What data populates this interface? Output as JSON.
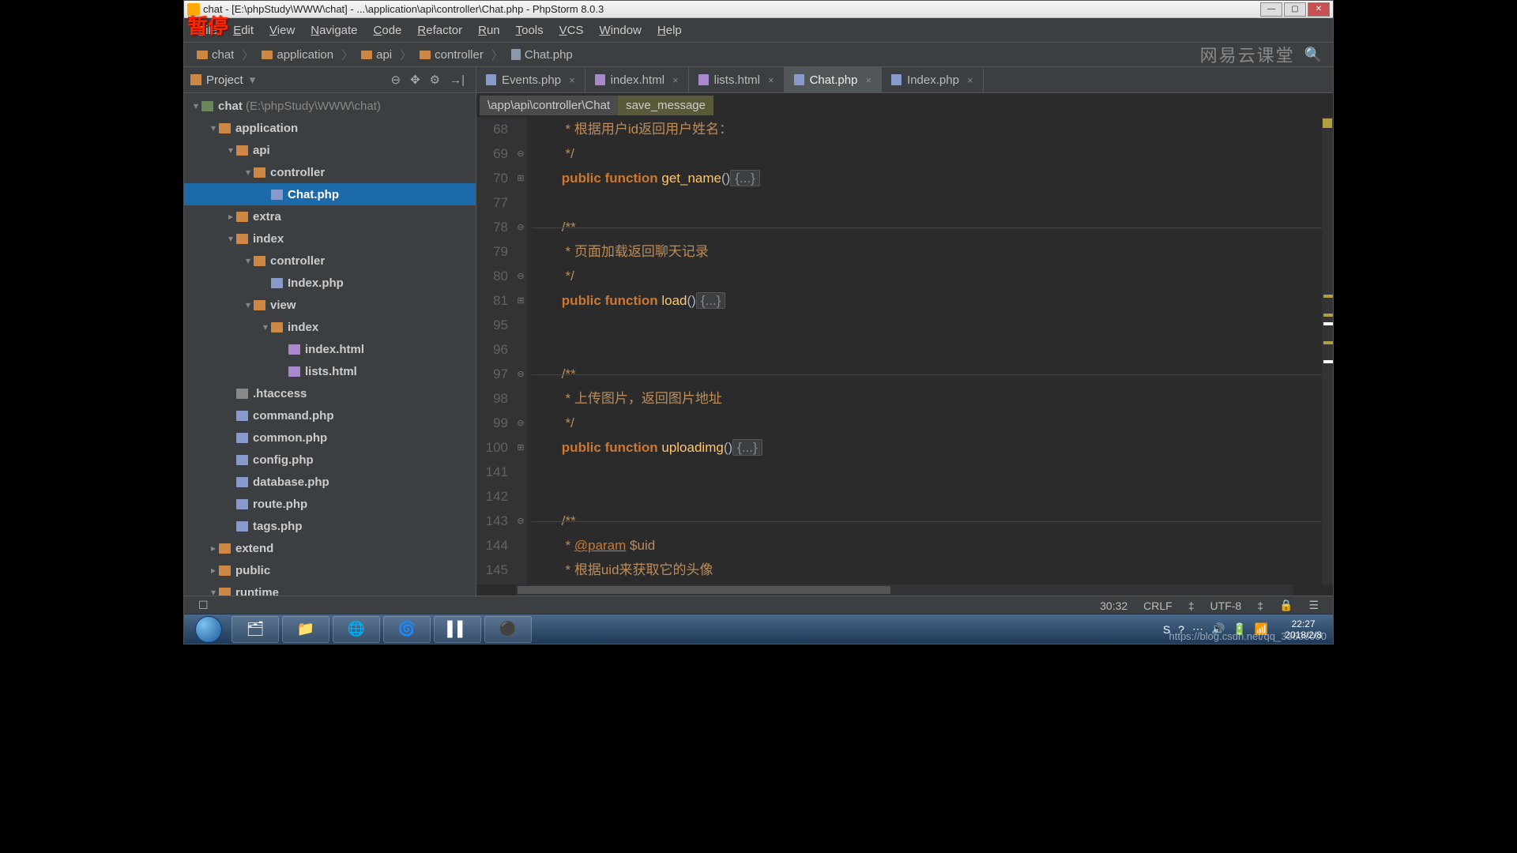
{
  "overlay": {
    "pause": "暂停"
  },
  "title": "chat - [E:\\phpStudy\\WWW\\chat] - ...\\application\\api\\controller\\Chat.php - PhpStorm 8.0.3",
  "menu": [
    "File",
    "Edit",
    "View",
    "Navigate",
    "Code",
    "Refactor",
    "Run",
    "Tools",
    "VCS",
    "Window",
    "Help"
  ],
  "breadcrumb": [
    {
      "type": "folder",
      "label": "chat"
    },
    {
      "type": "folder",
      "label": "application"
    },
    {
      "type": "folder",
      "label": "api"
    },
    {
      "type": "folder",
      "label": "controller"
    },
    {
      "type": "file",
      "label": "Chat.php"
    }
  ],
  "watermark_brand": "网易云课堂",
  "url_watermark": "https://blog.csdn.net/qq_33608000",
  "project": {
    "header": "Project",
    "tree": [
      {
        "d": 0,
        "t": "▾",
        "icon": "module",
        "label": "chat",
        "suffix": " (E:\\phpStudy\\WWW\\chat)"
      },
      {
        "d": 1,
        "t": "▾",
        "icon": "folder",
        "label": "application"
      },
      {
        "d": 2,
        "t": "▾",
        "icon": "folder",
        "label": "api"
      },
      {
        "d": 3,
        "t": "▾",
        "icon": "folder",
        "label": "controller"
      },
      {
        "d": 4,
        "t": "",
        "icon": "php",
        "label": "Chat.php",
        "selected": true
      },
      {
        "d": 2,
        "t": "▸",
        "icon": "folder",
        "label": "extra"
      },
      {
        "d": 2,
        "t": "▾",
        "icon": "folder",
        "label": "index"
      },
      {
        "d": 3,
        "t": "▾",
        "icon": "folder",
        "label": "controller"
      },
      {
        "d": 4,
        "t": "",
        "icon": "php",
        "label": "Index.php"
      },
      {
        "d": 3,
        "t": "▾",
        "icon": "folder",
        "label": "view"
      },
      {
        "d": 4,
        "t": "▾",
        "icon": "folder",
        "label": "index"
      },
      {
        "d": 5,
        "t": "",
        "icon": "html",
        "label": "index.html"
      },
      {
        "d": 5,
        "t": "",
        "icon": "html",
        "label": "lists.html"
      },
      {
        "d": 2,
        "t": "",
        "icon": "file",
        "label": ".htaccess"
      },
      {
        "d": 2,
        "t": "",
        "icon": "php",
        "label": "command.php"
      },
      {
        "d": 2,
        "t": "",
        "icon": "php",
        "label": "common.php"
      },
      {
        "d": 2,
        "t": "",
        "icon": "php",
        "label": "config.php"
      },
      {
        "d": 2,
        "t": "",
        "icon": "php",
        "label": "database.php"
      },
      {
        "d": 2,
        "t": "",
        "icon": "php",
        "label": "route.php"
      },
      {
        "d": 2,
        "t": "",
        "icon": "php",
        "label": "tags.php"
      },
      {
        "d": 1,
        "t": "▸",
        "icon": "folder",
        "label": "extend"
      },
      {
        "d": 1,
        "t": "▸",
        "icon": "folder",
        "label": "public"
      },
      {
        "d": 1,
        "t": "▾",
        "icon": "folder",
        "label": "runtime"
      }
    ]
  },
  "tabs": [
    {
      "label": "Events.php",
      "icon": "php"
    },
    {
      "label": "index.html",
      "icon": "html"
    },
    {
      "label": "lists.html",
      "icon": "html"
    },
    {
      "label": "Chat.php",
      "icon": "php",
      "active": true
    },
    {
      "label": "Index.php",
      "icon": "php"
    }
  ],
  "path_crumb": {
    "ns": "\\app\\api\\controller\\Chat",
    "member": "save_message"
  },
  "code": [
    {
      "n": 68,
      "f": "",
      "html": "         <span class='doc'>* 根据用户id返回用户姓名：</span>"
    },
    {
      "n": 69,
      "f": "⊖",
      "html": "         <span class='doc'>*/</span>"
    },
    {
      "n": 70,
      "f": "⊞",
      "html": "        <span class='kw'>public</span> <span class='kw'>function</span> <span class='fn'>get_name</span>()<span class='fold'>{...}</span>"
    },
    {
      "n": 77,
      "f": "",
      "html": ""
    },
    {
      "n": 78,
      "f": "⊖",
      "html": "        <span class='doc'>/**</span>",
      "sep": true
    },
    {
      "n": 79,
      "f": "",
      "html": "         <span class='doc'>* 页面加载返回聊天记录</span>"
    },
    {
      "n": 80,
      "f": "⊖",
      "html": "         <span class='doc'>*/</span>"
    },
    {
      "n": 81,
      "f": "⊞",
      "html": "        <span class='kw'>public</span> <span class='kw'>function</span> <span class='fn'>load</span>()<span class='fold'>{...}</span>"
    },
    {
      "n": 95,
      "f": "",
      "html": ""
    },
    {
      "n": 96,
      "f": "",
      "html": ""
    },
    {
      "n": 97,
      "f": "⊖",
      "html": "        <span class='doc'>/**</span>",
      "sep": true
    },
    {
      "n": 98,
      "f": "",
      "html": "         <span class='doc'>* 上传图片，返回图片地址</span>"
    },
    {
      "n": 99,
      "f": "⊖",
      "html": "         <span class='doc'>*/</span>"
    },
    {
      "n": 100,
      "f": "⊞",
      "html": "        <span class='kw'>public</span> <span class='kw'>function</span> <span class='fn'>uploadimg</span>()<span class='fold'>{...}</span>"
    },
    {
      "n": 141,
      "f": "",
      "html": ""
    },
    {
      "n": 142,
      "f": "",
      "html": ""
    },
    {
      "n": 143,
      "f": "⊖",
      "html": "        <span class='doc'>/**</span>",
      "sep": true
    },
    {
      "n": 144,
      "f": "",
      "html": "         <span class='doc'>* <span class='doctag'>@param</span> $uid</span>"
    },
    {
      "n": 145,
      "f": "",
      "html": "         <span class='doc'>* 根据uid来获取它的头像</span>"
    }
  ],
  "status": {
    "pos": "30:32",
    "le": "CRLF",
    "sep": "‡",
    "enc": "UTF-8",
    "div": "‡",
    "lock": "🔒",
    "man": "☰"
  },
  "taskbar": {
    "apps": [
      "🗂",
      "📁",
      "🌐",
      "🌀",
      "▌▌",
      "⚫"
    ],
    "tray": [
      "S",
      "?",
      "⋯",
      "🔊",
      "🔋",
      "📶"
    ],
    "time": "22:27",
    "date": "2018/2/8"
  }
}
